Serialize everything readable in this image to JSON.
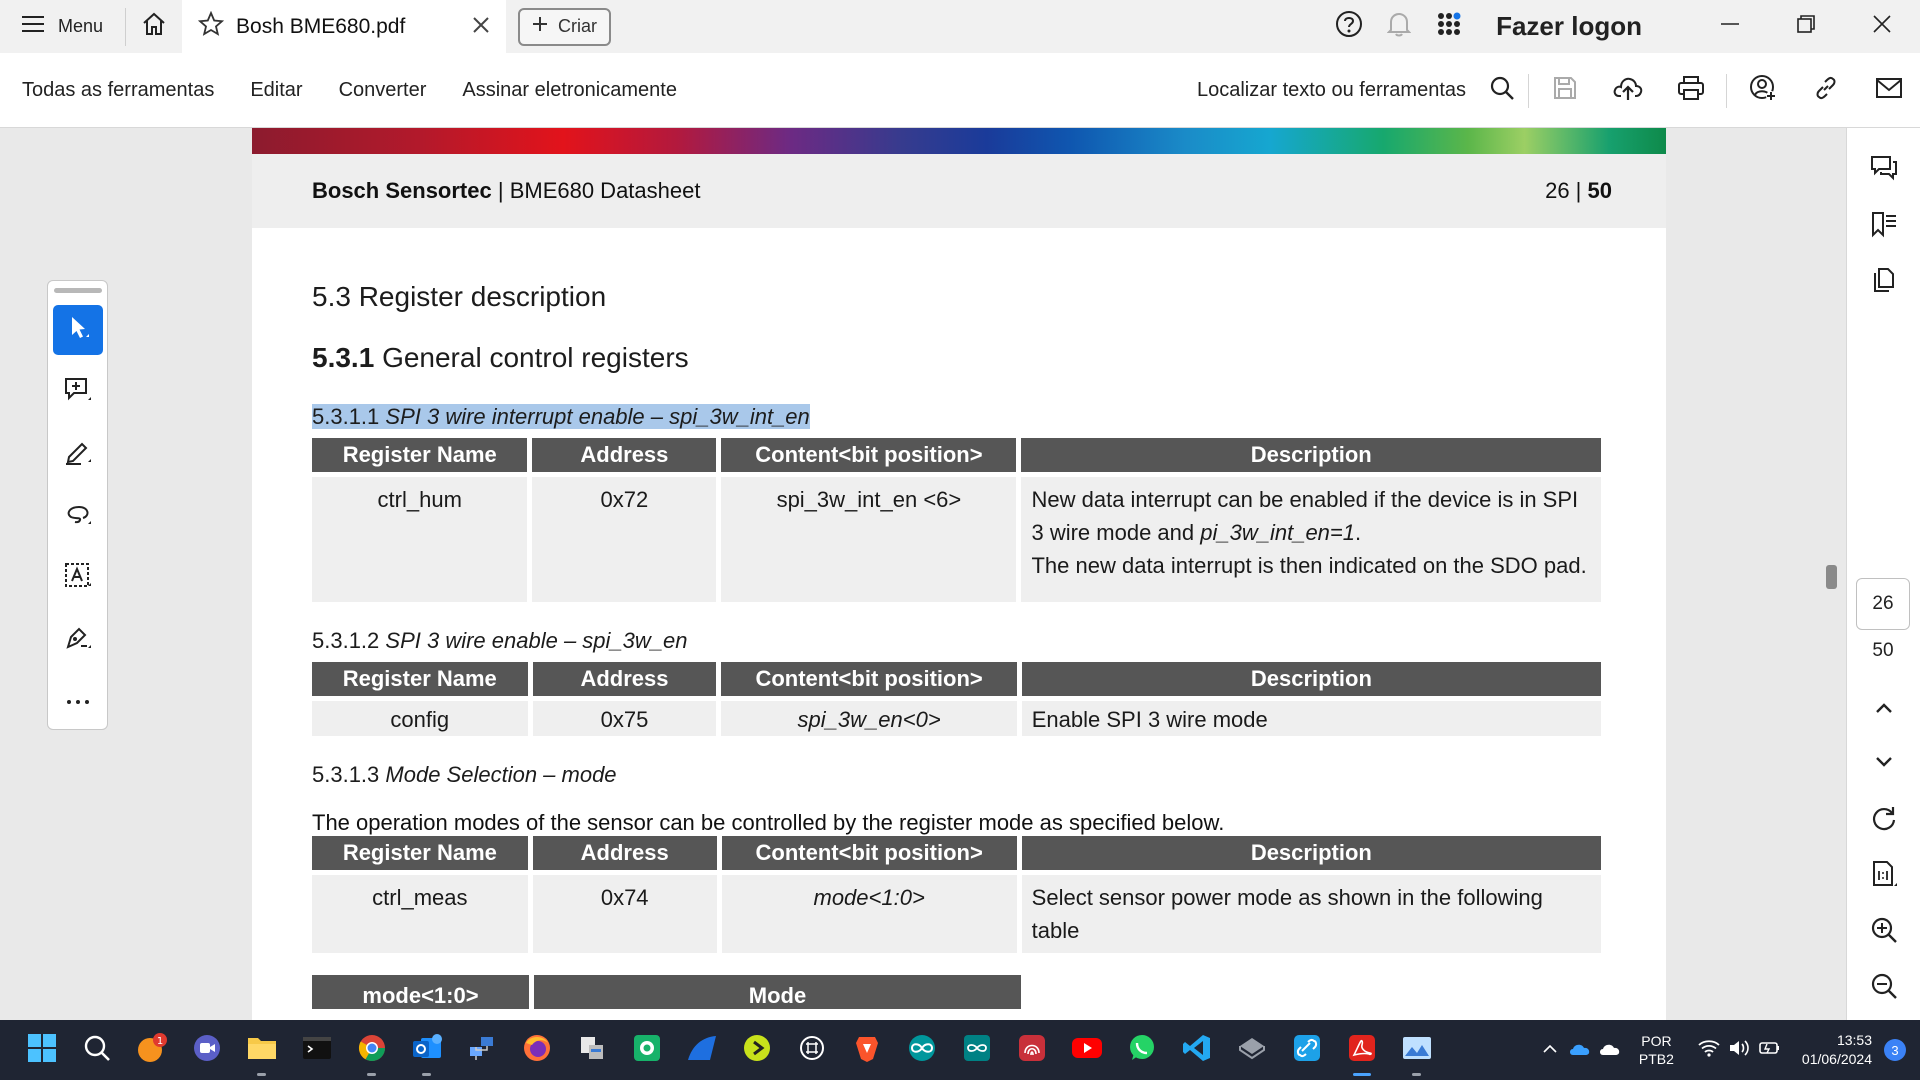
{
  "titlebar": {
    "menu_label": "Menu",
    "tab_title": "Bosh BME680.pdf",
    "create_label": "Criar",
    "login_label": "Fazer logon"
  },
  "toolbar": {
    "items": [
      "Todas as ferramentas",
      "Editar",
      "Converter",
      "Assinar eletronicamente"
    ],
    "find_label": "Localizar texto ou ferramentas"
  },
  "document": {
    "header_brand": "Bosch Sensortec",
    "header_title": "BME680 Datasheet",
    "page_current": "26",
    "page_total": "50",
    "section": "5.3 Register description",
    "subsection_num": "5.3.1",
    "subsection_title": "General control registers",
    "table_headers": [
      "Register Name",
      "Address",
      "Content<bit position>",
      "Description"
    ],
    "reg1": {
      "num": "5.3.1.1",
      "title": "SPI 3 wire interrupt enable – spi_3w_int_en",
      "name": "ctrl_hum",
      "address": "0x72",
      "content": "spi_3w_int_en <6>",
      "desc_a": "New data interrupt can be enabled if the device is in SPI 3 wire mode and ",
      "desc_b": "pi_3w_int_en=1",
      "desc_c": ".",
      "desc_d": "The new data interrupt is then indicated on the SDO pad."
    },
    "reg2": {
      "num": "5.3.1.2",
      "title": "SPI 3 wire enable – spi_3w_en",
      "name": "config",
      "address": "0x75",
      "content": "spi_3w_en<0>",
      "desc": "Enable  SPI 3 wire mode"
    },
    "reg3": {
      "num": "5.3.1.3",
      "title": "Mode Selection – mode",
      "intro": "The operation modes of the sensor can be controlled by the register mode as specified below.",
      "name": "ctrl_meas",
      "address": "0x74",
      "content": "mode<1:0>",
      "desc": "Select sensor power mode as shown in the following table"
    },
    "partial_headers": [
      "mode<1:0>",
      "Mode"
    ]
  },
  "sidepanel": {
    "page_current": "26",
    "page_total": "50"
  },
  "taskbar": {
    "badge_count": "1",
    "lang_top": "POR",
    "lang_bottom": "PTB2",
    "time": "13:53",
    "date": "01/06/2024",
    "notification_count": "3"
  },
  "colors": {
    "accent": "#1473e6",
    "table_header": "#565656",
    "table_cell": "#efefef",
    "selection": "#a9c8ea",
    "taskbar": "#1f2533"
  }
}
